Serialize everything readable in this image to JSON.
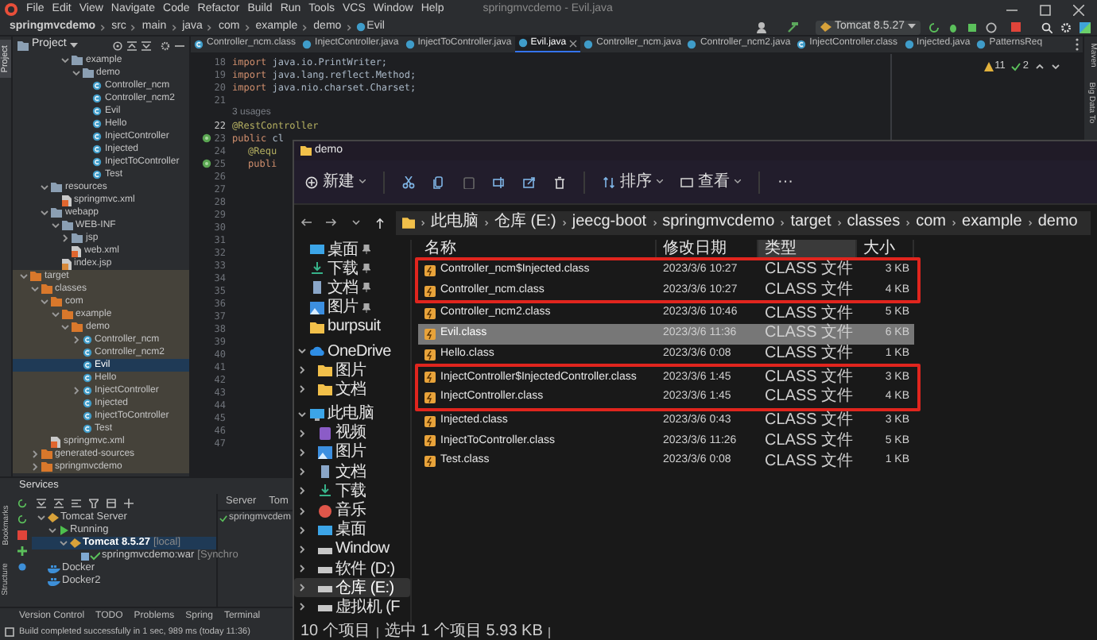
{
  "menu_bar": {
    "items": [
      "File",
      "Edit",
      "View",
      "Navigate",
      "Code",
      "Refactor",
      "Build",
      "Run",
      "Tools",
      "VCS",
      "Window",
      "Help"
    ],
    "title": "springmvcdemo - Evil.java"
  },
  "navigation_bar": {
    "breadcrumbs": [
      "springmvcdemo",
      "src",
      "main",
      "java",
      "com",
      "example",
      "demo",
      "Evil"
    ],
    "run_configuration": "Tomcat 8.5.27"
  },
  "left_stripe": {
    "top": "Project",
    "bottom": [
      "Bookmarks",
      "Structure"
    ]
  },
  "project_panel": {
    "title": "Project",
    "tree": [
      {
        "label": "example",
        "kind": "package",
        "expanded": true,
        "selected": false,
        "children": [
          {
            "label": "demo",
            "kind": "package",
            "expanded": true,
            "selected": false,
            "children": [
              {
                "label": "Controller_ncm",
                "kind": "class",
                "selected": false
              },
              {
                "label": "Controller_ncm2",
                "kind": "class",
                "selected": false
              },
              {
                "label": "Evil",
                "kind": "class",
                "selected": false
              },
              {
                "label": "Hello",
                "kind": "class",
                "selected": false
              },
              {
                "label": "InjectController",
                "kind": "class",
                "selected": false
              },
              {
                "label": "Injected",
                "kind": "class",
                "selected": false
              },
              {
                "label": "InjectToController",
                "kind": "class",
                "selected": false
              },
              {
                "label": "Test",
                "kind": "class",
                "selected": false
              }
            ]
          }
        ]
      },
      {
        "label": "resources",
        "kind": "folder",
        "expanded": true,
        "selected": false,
        "children": [
          {
            "label": "springmvc.xml",
            "kind": "xml",
            "selected": false
          }
        ]
      },
      {
        "label": "webapp",
        "kind": "folder",
        "expanded": true,
        "selected": false,
        "children": [
          {
            "label": "WEB-INF",
            "kind": "folder",
            "expanded": true,
            "selected": false,
            "children": [
              {
                "label": "jsp",
                "kind": "folder",
                "expanded": false,
                "selected": false
              },
              {
                "label": "web.xml",
                "kind": "xml",
                "selected": false
              }
            ]
          },
          {
            "label": "index.jsp",
            "kind": "jsp",
            "selected": false
          }
        ]
      },
      {
        "label": "target",
        "kind": "output_folder",
        "expanded": true,
        "selected": false,
        "children": [
          {
            "label": "classes",
            "kind": "output_folder",
            "expanded": true,
            "selected": false,
            "children": [
              {
                "label": "com",
                "kind": "output_folder",
                "expanded": true,
                "selected": false,
                "children": [
                  {
                    "label": "example",
                    "kind": "output_folder",
                    "expanded": true,
                    "selected": false,
                    "children": [
                      {
                        "label": "demo",
                        "kind": "output_folder",
                        "expanded": true,
                        "selected": false,
                        "children": [
                          {
                            "label": "Controller_ncm",
                            "kind": "class",
                            "expanded": false,
                            "selected": false
                          },
                          {
                            "label": "Controller_ncm2",
                            "kind": "class",
                            "selected": false
                          },
                          {
                            "label": "Evil",
                            "kind": "class",
                            "selected": true
                          },
                          {
                            "label": "Hello",
                            "kind": "class",
                            "selected": false
                          },
                          {
                            "label": "InjectController",
                            "kind": "class",
                            "expanded": false,
                            "selected": false
                          },
                          {
                            "label": "Injected",
                            "kind": "class",
                            "selected": false
                          },
                          {
                            "label": "InjectToController",
                            "kind": "class",
                            "selected": false
                          },
                          {
                            "label": "Test",
                            "kind": "class",
                            "selected": false
                          }
                        ]
                      }
                    ]
                  }
                ]
              },
              {
                "label": "springmvc.xml",
                "kind": "xml",
                "selected": false
              }
            ]
          },
          {
            "label": "generated-sources",
            "kind": "output_folder",
            "expanded": false,
            "selected": false
          },
          {
            "label": "springmvcdemo",
            "kind": "output_folder",
            "expanded": false,
            "selected": false
          }
        ]
      }
    ]
  },
  "editor": {
    "tabs": [
      {
        "label": "Controller_ncm.class",
        "kind": "class",
        "selected": false
      },
      {
        "label": "InjectController.java",
        "kind": "java",
        "selected": false
      },
      {
        "label": "InjectToController.java",
        "kind": "java",
        "selected": false
      },
      {
        "label": "Evil.java",
        "kind": "java",
        "selected": true
      },
      {
        "label": "Controller_ncm.java",
        "kind": "java",
        "selected": false
      },
      {
        "label": "Controller_ncm2.java",
        "kind": "java",
        "selected": false
      },
      {
        "label": "InjectController.class",
        "kind": "class",
        "selected": false
      },
      {
        "label": "Injected.java",
        "kind": "java",
        "selected": false
      },
      {
        "label": "PatternsReq",
        "kind": "java",
        "selected": false
      }
    ],
    "inspections": {
      "warnings": "11",
      "passed": "2"
    },
    "lines": [
      {
        "kind": "import",
        "number": "18",
        "keyword": "import",
        "text": "java.io.PrintWriter;"
      },
      {
        "kind": "import",
        "number": "19",
        "keyword": "import",
        "text": "java.lang.reflect.Method;"
      },
      {
        "kind": "import",
        "number": "20",
        "keyword": "import",
        "text": "java.nio.charset.Charset;"
      },
      {
        "kind": "plain",
        "number": "21"
      },
      {
        "kind": "hint",
        "text": "3 usages"
      },
      {
        "kind": "annotation",
        "number": "22",
        "text": "@RestController"
      },
      {
        "kind": "declaration",
        "number": "23",
        "keyword": "public",
        "text": "cl",
        "gutter_icon": true
      },
      {
        "kind": "annotation",
        "number": "24",
        "text": "@Requ",
        "indent": true
      },
      {
        "kind": "declaration",
        "number": "25",
        "keyword": "publi",
        "indent": true,
        "gutter_icon": true
      },
      {
        "kind": "plain",
        "number": "26"
      },
      {
        "kind": "plain",
        "number": "27"
      },
      {
        "kind": "plain",
        "number": "28"
      },
      {
        "kind": "plain",
        "number": "29"
      },
      {
        "kind": "plain",
        "number": "30"
      },
      {
        "kind": "plain",
        "number": "31"
      },
      {
        "kind": "plain",
        "number": "32"
      },
      {
        "kind": "plain",
        "number": "33"
      },
      {
        "kind": "plain",
        "number": "34"
      },
      {
        "kind": "plain",
        "number": "35"
      },
      {
        "kind": "plain",
        "number": "36"
      },
      {
        "kind": "plain",
        "number": "37"
      },
      {
        "kind": "plain",
        "number": "38"
      },
      {
        "kind": "plain",
        "number": "39"
      },
      {
        "kind": "plain",
        "number": "40"
      },
      {
        "kind": "plain",
        "number": "41"
      },
      {
        "kind": "plain",
        "number": "42"
      },
      {
        "kind": "plain",
        "number": "43"
      },
      {
        "kind": "plain",
        "number": "44"
      },
      {
        "kind": "plain",
        "number": "45"
      },
      {
        "kind": "plain",
        "number": "46"
      },
      {
        "kind": "plain",
        "number": "47"
      }
    ]
  },
  "right_stripe": [
    "Maven",
    "Big Data To"
  ],
  "services": {
    "title": "Services",
    "tree": [
      {
        "label": "Tomcat Server",
        "kind": "server",
        "expanded": true,
        "selected": false,
        "children": [
          {
            "label": "Running",
            "kind": "running",
            "expanded": true,
            "selected": false,
            "children": [
              {
                "label": "Tomcat 8.5.27",
                "note": "[local]",
                "kind": "tomcat",
                "expanded": true,
                "selected": true,
                "children": [
                  {
                    "label": "springmvcdemo:war",
                    "note": "[Synchro",
                    "kind": "artifact",
                    "selected": false
                  }
                ]
              }
            ]
          }
        ]
      },
      {
        "label": "Docker",
        "kind": "docker",
        "selected": false
      },
      {
        "label": "Docker2",
        "kind": "docker",
        "selected": false
      }
    ],
    "detail_tabs": [
      "Server",
      "Tom"
    ],
    "detail_item": "springmvcdem"
  },
  "tool_windows": [
    "Version Control",
    "TODO",
    "Problems",
    "Spring",
    "Terminal"
  ],
  "status_bar": "Build completed successfully in 1 sec, 989 ms (today 11:36)",
  "explorer": {
    "title": "demo",
    "toolbar": [
      {
        "kind": "new",
        "label": "新建"
      },
      {
        "kind": "cut"
      },
      {
        "kind": "copy"
      },
      {
        "kind": "paste"
      },
      {
        "kind": "rename"
      },
      {
        "kind": "share"
      },
      {
        "kind": "delete"
      },
      {
        "kind": "sort",
        "label": "排序"
      },
      {
        "kind": "view",
        "label": "查看"
      },
      {
        "kind": "more",
        "label": "···"
      }
    ],
    "path": [
      "此电脑",
      "仓库 (E:)",
      "jeecg-boot",
      "springmvcdemo",
      "target",
      "classes",
      "com",
      "example",
      "demo"
    ],
    "sidebar": [
      {
        "label": "桌面",
        "kind": "desktop",
        "pinned": true,
        "selected": false
      },
      {
        "label": "下载",
        "kind": "download",
        "pinned": true,
        "selected": false
      },
      {
        "label": "文档",
        "kind": "document",
        "pinned": true,
        "selected": false
      },
      {
        "label": "图片",
        "kind": "picture",
        "pinned": true,
        "selected": false
      },
      {
        "label": "burpsuit",
        "kind": "folder",
        "pinned": false,
        "selected": false
      },
      {
        "label": "OneDrive",
        "kind": "cloud",
        "pinned": false,
        "expanded": true,
        "selected": false,
        "children": [
          {
            "label": "图片",
            "kind": "folder",
            "pinned": false,
            "expanded": false,
            "selected": false
          },
          {
            "label": "文档",
            "kind": "folder",
            "pinned": false,
            "expanded": false,
            "selected": false
          }
        ]
      },
      {
        "label": "此电脑",
        "kind": "pc",
        "pinned": false,
        "expanded": true,
        "selected": false,
        "children": [
          {
            "label": "视频",
            "kind": "video",
            "pinned": false,
            "expanded": false,
            "selected": false
          },
          {
            "label": "图片",
            "kind": "picture",
            "pinned": false,
            "expanded": false,
            "selected": false
          },
          {
            "label": "文档",
            "kind": "document",
            "pinned": false,
            "expanded": false,
            "selected": false
          },
          {
            "label": "下载",
            "kind": "download",
            "pinned": false,
            "expanded": false,
            "selected": false
          },
          {
            "label": "音乐",
            "kind": "music",
            "pinned": false,
            "expanded": false,
            "selected": false
          },
          {
            "label": "桌面",
            "kind": "desktop",
            "pinned": false,
            "expanded": false,
            "selected": false
          },
          {
            "label": "Window",
            "kind": "drive",
            "pinned": false,
            "expanded": false,
            "selected": false
          },
          {
            "label": "软件 (D:)",
            "kind": "drive",
            "pinned": false,
            "expanded": false,
            "selected": false
          },
          {
            "label": "仓库 (E:)",
            "kind": "drive",
            "pinned": false,
            "expanded": false,
            "selected": true
          },
          {
            "label": "虚拟机 (F",
            "kind": "drive",
            "pinned": false,
            "expanded": false,
            "selected": false
          }
        ]
      }
    ],
    "columns": [
      {
        "label": "名称",
        "highlighted": false
      },
      {
        "label": "修改日期",
        "highlighted": false
      },
      {
        "label": "类型",
        "highlighted": true
      },
      {
        "label": "大小",
        "highlighted": false
      }
    ],
    "files": [
      {
        "name": "Controller_ncm$Injected.class",
        "modified": "2023/3/6 10:27",
        "type": "CLASS 文件",
        "size": "3 KB",
        "selected": false,
        "outlined": true
      },
      {
        "name": "Controller_ncm.class",
        "modified": "2023/3/6 10:27",
        "type": "CLASS 文件",
        "size": "4 KB",
        "selected": false,
        "outlined": true
      },
      {
        "name": "Controller_ncm2.class",
        "modified": "2023/3/6 10:46",
        "type": "CLASS 文件",
        "size": "5 KB",
        "selected": false,
        "outlined": false
      },
      {
        "name": "Evil.class",
        "modified": "2023/3/6 11:36",
        "type": "CLASS 文件",
        "size": "6 KB",
        "selected": true,
        "outlined": false
      },
      {
        "name": "Hello.class",
        "modified": "2023/3/6 0:08",
        "type": "CLASS 文件",
        "size": "1 KB",
        "selected": false,
        "outlined": false
      },
      {
        "name": "InjectController$InjectedController.class",
        "modified": "2023/3/6 1:45",
        "type": "CLASS 文件",
        "size": "3 KB",
        "selected": false,
        "outlined": true
      },
      {
        "name": "InjectController.class",
        "modified": "2023/3/6 1:45",
        "type": "CLASS 文件",
        "size": "4 KB",
        "selected": false,
        "outlined": true
      },
      {
        "name": "Injected.class",
        "modified": "2023/3/6 0:43",
        "type": "CLASS 文件",
        "size": "3 KB",
        "selected": false,
        "outlined": false
      },
      {
        "name": "InjectToController.class",
        "modified": "2023/3/6 11:26",
        "type": "CLASS 文件",
        "size": "5 KB",
        "selected": false,
        "outlined": false
      },
      {
        "name": "Test.class",
        "modified": "2023/3/6 0:08",
        "type": "CLASS 文件",
        "size": "1 KB",
        "selected": false,
        "outlined": false
      }
    ],
    "status": {
      "count": "10 个项目",
      "selection": "选中 1 个项目 5.93 KB"
    }
  }
}
